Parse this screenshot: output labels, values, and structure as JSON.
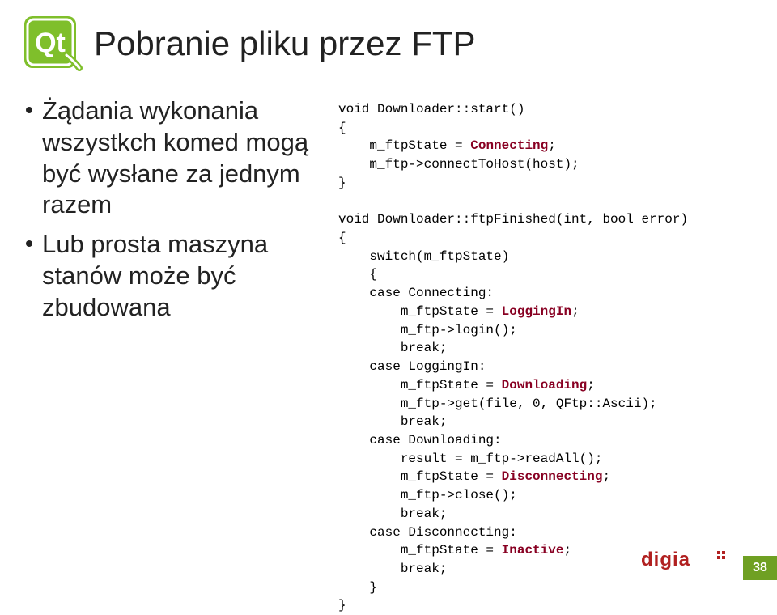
{
  "title": "Pobranie pliku przez FTP",
  "bullets": [
    "Żądania wykonania wszystkch komed mogą być wysłane za jednym razem",
    "Lub prosta maszyna stanów może być zbudowana"
  ],
  "code": {
    "l1": "void Downloader::start()",
    "l2": "{",
    "l3": "    m_ftpState = ",
    "l3b": "Connecting",
    "l3c": ";",
    "l4": "    m_ftp->connectToHost(host);",
    "l5": "}",
    "l6": "",
    "l7": "void Downloader::ftpFinished(int, bool error)",
    "l8": "{",
    "l9": "    switch(m_ftpState)",
    "l10": "    {",
    "l11": "    case Connecting:",
    "l12": "        m_ftpState = ",
    "l12b": "LoggingIn",
    "l12c": ";",
    "l13": "        m_ftp->login();",
    "l14": "        break;",
    "l15": "    case LoggingIn:",
    "l16": "        m_ftpState = ",
    "l16b": "Downloading",
    "l16c": ";",
    "l17": "        m_ftp->get(file, 0, QFtp::Ascii);",
    "l18": "        break;",
    "l19": "    case Downloading:",
    "l20": "        result = m_ftp->readAll();",
    "l21": "        m_ftpState = ",
    "l21b": "Disconnecting",
    "l21c": ";",
    "l22": "        m_ftp->close();",
    "l23": "        break;",
    "l24": "    case Disconnecting:",
    "l25": "        m_ftpState = ",
    "l25b": "Inactive",
    "l25c": ";",
    "l26": "        break;",
    "l27": "    }",
    "l28": "}"
  },
  "pagenum": "38"
}
